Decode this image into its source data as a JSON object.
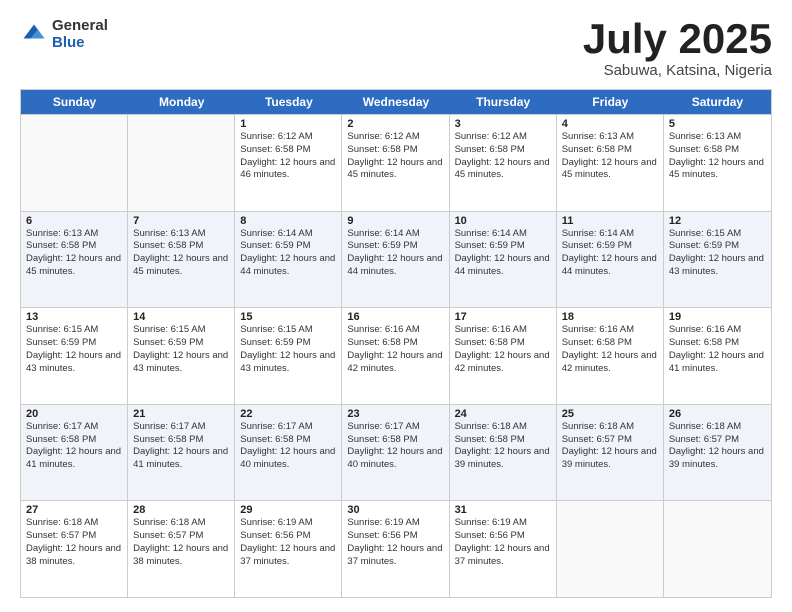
{
  "logo": {
    "general": "General",
    "blue": "Blue"
  },
  "title": {
    "month": "July 2025",
    "location": "Sabuwa, Katsina, Nigeria"
  },
  "days_of_week": [
    "Sunday",
    "Monday",
    "Tuesday",
    "Wednesday",
    "Thursday",
    "Friday",
    "Saturday"
  ],
  "weeks": [
    [
      {
        "day": "",
        "info": ""
      },
      {
        "day": "",
        "info": ""
      },
      {
        "day": "1",
        "info": "Sunrise: 6:12 AM\nSunset: 6:58 PM\nDaylight: 12 hours and 46 minutes."
      },
      {
        "day": "2",
        "info": "Sunrise: 6:12 AM\nSunset: 6:58 PM\nDaylight: 12 hours and 45 minutes."
      },
      {
        "day": "3",
        "info": "Sunrise: 6:12 AM\nSunset: 6:58 PM\nDaylight: 12 hours and 45 minutes."
      },
      {
        "day": "4",
        "info": "Sunrise: 6:13 AM\nSunset: 6:58 PM\nDaylight: 12 hours and 45 minutes."
      },
      {
        "day": "5",
        "info": "Sunrise: 6:13 AM\nSunset: 6:58 PM\nDaylight: 12 hours and 45 minutes."
      }
    ],
    [
      {
        "day": "6",
        "info": "Sunrise: 6:13 AM\nSunset: 6:58 PM\nDaylight: 12 hours and 45 minutes."
      },
      {
        "day": "7",
        "info": "Sunrise: 6:13 AM\nSunset: 6:58 PM\nDaylight: 12 hours and 45 minutes."
      },
      {
        "day": "8",
        "info": "Sunrise: 6:14 AM\nSunset: 6:59 PM\nDaylight: 12 hours and 44 minutes."
      },
      {
        "day": "9",
        "info": "Sunrise: 6:14 AM\nSunset: 6:59 PM\nDaylight: 12 hours and 44 minutes."
      },
      {
        "day": "10",
        "info": "Sunrise: 6:14 AM\nSunset: 6:59 PM\nDaylight: 12 hours and 44 minutes."
      },
      {
        "day": "11",
        "info": "Sunrise: 6:14 AM\nSunset: 6:59 PM\nDaylight: 12 hours and 44 minutes."
      },
      {
        "day": "12",
        "info": "Sunrise: 6:15 AM\nSunset: 6:59 PM\nDaylight: 12 hours and 43 minutes."
      }
    ],
    [
      {
        "day": "13",
        "info": "Sunrise: 6:15 AM\nSunset: 6:59 PM\nDaylight: 12 hours and 43 minutes."
      },
      {
        "day": "14",
        "info": "Sunrise: 6:15 AM\nSunset: 6:59 PM\nDaylight: 12 hours and 43 minutes."
      },
      {
        "day": "15",
        "info": "Sunrise: 6:15 AM\nSunset: 6:59 PM\nDaylight: 12 hours and 43 minutes."
      },
      {
        "day": "16",
        "info": "Sunrise: 6:16 AM\nSunset: 6:58 PM\nDaylight: 12 hours and 42 minutes."
      },
      {
        "day": "17",
        "info": "Sunrise: 6:16 AM\nSunset: 6:58 PM\nDaylight: 12 hours and 42 minutes."
      },
      {
        "day": "18",
        "info": "Sunrise: 6:16 AM\nSunset: 6:58 PM\nDaylight: 12 hours and 42 minutes."
      },
      {
        "day": "19",
        "info": "Sunrise: 6:16 AM\nSunset: 6:58 PM\nDaylight: 12 hours and 41 minutes."
      }
    ],
    [
      {
        "day": "20",
        "info": "Sunrise: 6:17 AM\nSunset: 6:58 PM\nDaylight: 12 hours and 41 minutes."
      },
      {
        "day": "21",
        "info": "Sunrise: 6:17 AM\nSunset: 6:58 PM\nDaylight: 12 hours and 41 minutes."
      },
      {
        "day": "22",
        "info": "Sunrise: 6:17 AM\nSunset: 6:58 PM\nDaylight: 12 hours and 40 minutes."
      },
      {
        "day": "23",
        "info": "Sunrise: 6:17 AM\nSunset: 6:58 PM\nDaylight: 12 hours and 40 minutes."
      },
      {
        "day": "24",
        "info": "Sunrise: 6:18 AM\nSunset: 6:58 PM\nDaylight: 12 hours and 39 minutes."
      },
      {
        "day": "25",
        "info": "Sunrise: 6:18 AM\nSunset: 6:57 PM\nDaylight: 12 hours and 39 minutes."
      },
      {
        "day": "26",
        "info": "Sunrise: 6:18 AM\nSunset: 6:57 PM\nDaylight: 12 hours and 39 minutes."
      }
    ],
    [
      {
        "day": "27",
        "info": "Sunrise: 6:18 AM\nSunset: 6:57 PM\nDaylight: 12 hours and 38 minutes."
      },
      {
        "day": "28",
        "info": "Sunrise: 6:18 AM\nSunset: 6:57 PM\nDaylight: 12 hours and 38 minutes."
      },
      {
        "day": "29",
        "info": "Sunrise: 6:19 AM\nSunset: 6:56 PM\nDaylight: 12 hours and 37 minutes."
      },
      {
        "day": "30",
        "info": "Sunrise: 6:19 AM\nSunset: 6:56 PM\nDaylight: 12 hours and 37 minutes."
      },
      {
        "day": "31",
        "info": "Sunrise: 6:19 AM\nSunset: 6:56 PM\nDaylight: 12 hours and 37 minutes."
      },
      {
        "day": "",
        "info": ""
      },
      {
        "day": "",
        "info": ""
      }
    ]
  ]
}
